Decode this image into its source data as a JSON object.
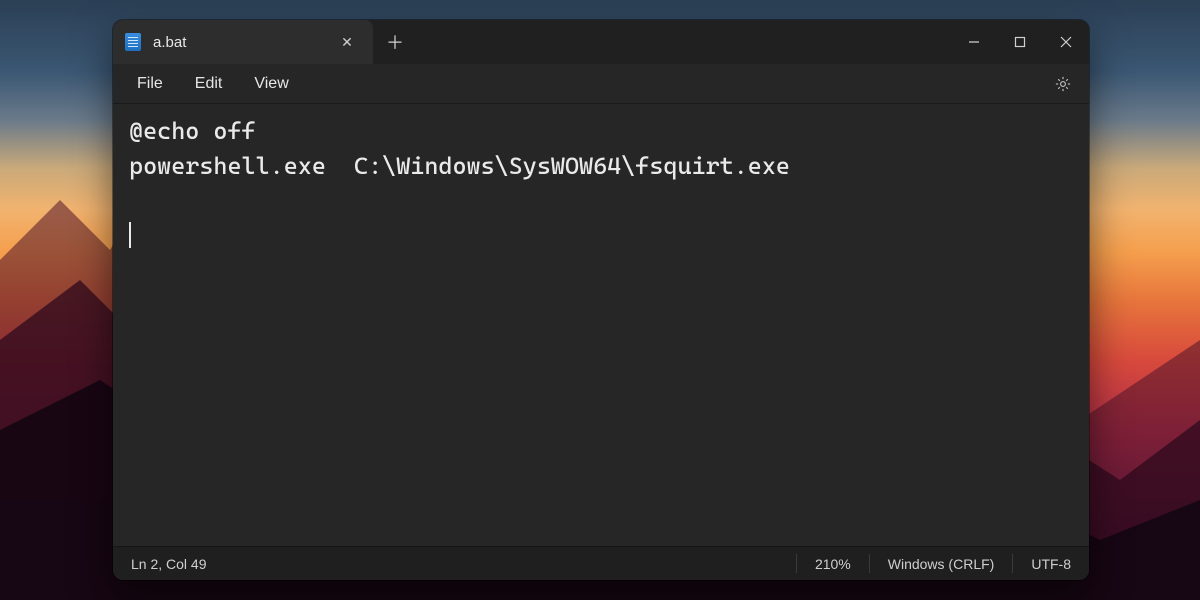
{
  "tab": {
    "title": "a.bat"
  },
  "menus": {
    "file": "File",
    "edit": "Edit",
    "view": "View"
  },
  "editor": {
    "content": "@echo off\npowershell.exe  C:\\Windows\\SysWOW64\\fsquirt.exe"
  },
  "status": {
    "cursor": "Ln 2, Col 49",
    "zoom": "210%",
    "eol": "Windows (CRLF)",
    "encoding": "UTF-8"
  },
  "icons": {
    "close_glyph": "✕",
    "plus_glyph": "＋"
  }
}
